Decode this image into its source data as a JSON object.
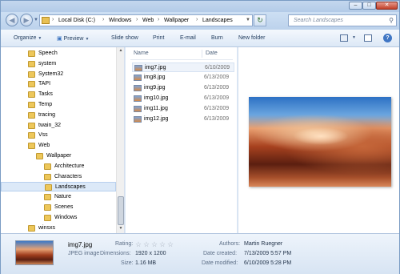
{
  "window": {
    "controls": {
      "minimize": "–",
      "maximize": "□",
      "close": "✕"
    }
  },
  "address_bar": {
    "crumbs": [
      "Local Disk (C:)",
      "Windows",
      "Web",
      "Wallpaper",
      "Landscapes"
    ],
    "separator": "›"
  },
  "search": {
    "placeholder": "Search Landscapes"
  },
  "toolbar": {
    "organize": "Organize",
    "preview": "Preview",
    "slideshow": "Slide show",
    "print": "Print",
    "email": "E-mail",
    "burn": "Burn",
    "new_folder": "New folder"
  },
  "nav_tree": {
    "items": [
      {
        "label": "Speech",
        "level": 0
      },
      {
        "label": "system",
        "level": 0
      },
      {
        "label": "System32",
        "level": 0
      },
      {
        "label": "TAPI",
        "level": 0
      },
      {
        "label": "Tasks",
        "level": 0
      },
      {
        "label": "Temp",
        "level": 0
      },
      {
        "label": "tracing",
        "level": 0
      },
      {
        "label": "twain_32",
        "level": 0
      },
      {
        "label": "Vss",
        "level": 0
      },
      {
        "label": "Web",
        "level": 0
      },
      {
        "label": "Wallpaper",
        "level": 1
      },
      {
        "label": "Architecture",
        "level": 2
      },
      {
        "label": "Characters",
        "level": 2
      },
      {
        "label": "Landscapes",
        "level": 2,
        "selected": true
      },
      {
        "label": "Nature",
        "level": 2
      },
      {
        "label": "Scenes",
        "level": 2
      },
      {
        "label": "Windows",
        "level": 2
      },
      {
        "label": "winsxs",
        "level": 0
      }
    ]
  },
  "file_list": {
    "columns": {
      "name": "Name",
      "date": "Date"
    },
    "files": [
      {
        "name": "img7.jpg",
        "date": "6/10/2009",
        "selected": true
      },
      {
        "name": "img8.jpg",
        "date": "6/13/2009"
      },
      {
        "name": "img9.jpg",
        "date": "6/13/2009"
      },
      {
        "name": "img10.jpg",
        "date": "6/13/2009"
      },
      {
        "name": "img11.jpg",
        "date": "6/13/2009"
      },
      {
        "name": "img12.jpg",
        "date": "6/13/2009"
      }
    ]
  },
  "details": {
    "filename": "img7.jpg",
    "filetype": "JPEG image",
    "rating_label": "Rating:",
    "rating_stars": 0,
    "rating_max": 5,
    "dimensions_label": "Dimensions:",
    "dimensions": "1920 x 1200",
    "size_label": "Size:",
    "size": "1.16 MB",
    "authors_label": "Authors:",
    "authors": "Martin Ruegner",
    "date_created_label": "Date created:",
    "date_created": "7/13/2009 5:57 PM",
    "date_modified_label": "Date modified:",
    "date_modified": "6/10/2009 5:28 PM"
  }
}
